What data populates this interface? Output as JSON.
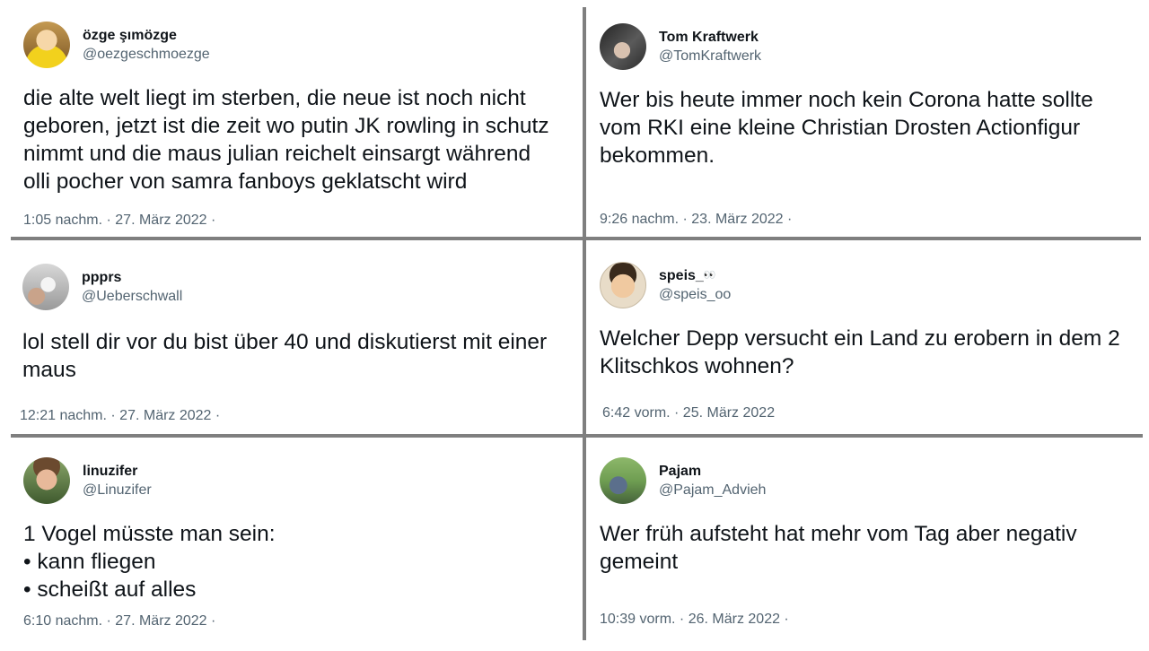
{
  "tweets": [
    {
      "display_name": "özge şımözge",
      "handle": "@oezgeschmoezge",
      "text": "die alte welt liegt im sterben, die neue ist noch nicht\ngeboren, jetzt ist die zeit wo putin JK rowling in schutz\nnimmt und die maus julian reichelt einsargt während\nolli pocher von samra fanboys geklatscht wird",
      "meta": "1:05 nachm. · 27. März 2022 ·"
    },
    {
      "display_name": "Tom Kraftwerk",
      "handle": "@TomKraftwerk",
      "text": "Wer bis heute immer noch kein Corona hatte sollte\nvom RKI eine kleine Christian Drosten Actionfigur\nbekommen.",
      "meta": "9:26 nachm. · 23. März 2022 ·"
    },
    {
      "display_name": "ppprs",
      "handle": "@Ueberschwall",
      "text": "lol stell dir vor du bist über 40 und diskutierst mit einer\nmaus",
      "meta": "12:21 nachm. · 27. März 2022 ·"
    },
    {
      "display_name": "speis_",
      "name_suffix": "👀",
      "handle": "@speis_oo",
      "text": "Welcher Depp versucht ein Land zu erobern in dem 2\nKlitschkos wohnen?",
      "meta": "6:42 vorm. · 25. März 2022"
    },
    {
      "display_name": "linuzifer",
      "handle": "@Linuzifer",
      "text": "1 Vogel müsste man sein:\n• kann fliegen\n• scheißt auf alles",
      "meta": "6:10 nachm. · 27. März 2022 ·"
    },
    {
      "display_name": "Pajam",
      "handle": "@Pajam_Advieh",
      "text": "Wer früh aufsteht hat mehr vom Tag aber negativ\ngemeint",
      "meta": "10:39 vorm. · 26. März 2022 ·"
    }
  ]
}
